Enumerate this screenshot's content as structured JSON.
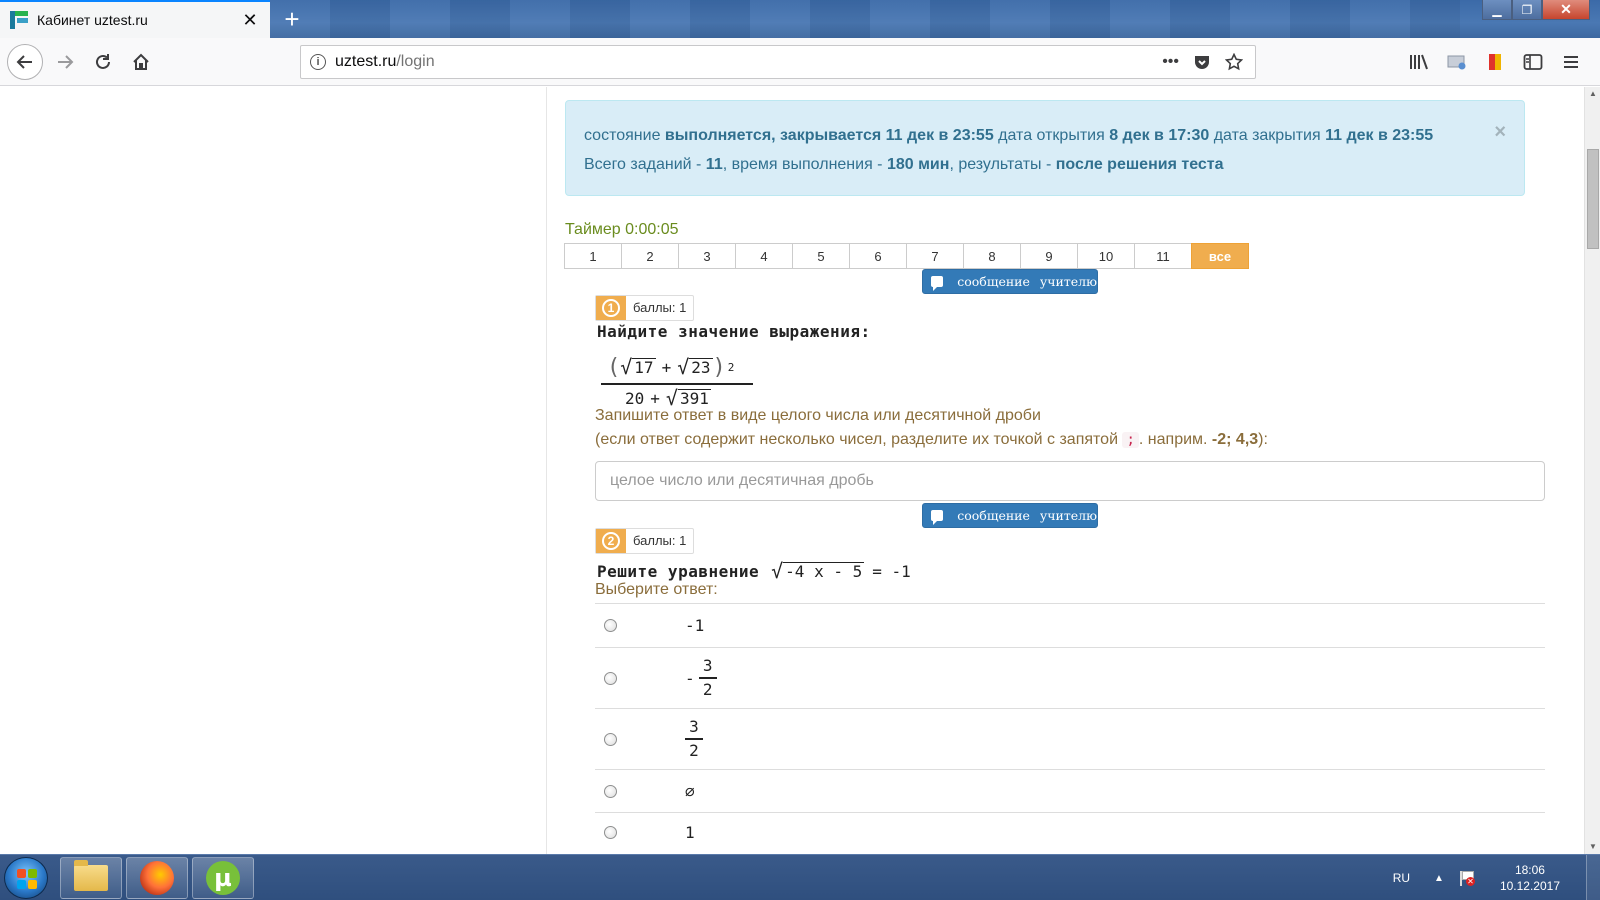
{
  "browser": {
    "tab_title": "Кабинет uztest.ru",
    "url_host": "uztest.ru",
    "url_path": "/login",
    "new_tab": "+",
    "tab_close": "✕",
    "more_actions": "•••"
  },
  "alert": {
    "line1": [
      {
        "t": "состояние ",
        "b": false
      },
      {
        "t": "выполняется, закрывается 11 дек в 23:55",
        "b": true
      },
      {
        "t": " дата открытия ",
        "b": false
      },
      {
        "t": "8 дек в 17:30",
        "b": true
      },
      {
        "t": " дата закрытия ",
        "b": false
      },
      {
        "t": "11 дек в 23:55",
        "b": true
      }
    ],
    "line2": [
      {
        "t": "Всего заданий - ",
        "b": false
      },
      {
        "t": "11",
        "b": true
      },
      {
        "t": ", время выполнения - ",
        "b": false
      },
      {
        "t": "180 мин",
        "b": true
      },
      {
        "t": ", результаты - ",
        "b": false
      },
      {
        "t": "после решения теста",
        "b": true
      }
    ],
    "close": "×"
  },
  "timer": "Таймер 0:00:05",
  "question_nav": [
    "1",
    "2",
    "3",
    "4",
    "5",
    "6",
    "7",
    "8",
    "9",
    "10",
    "11",
    "все"
  ],
  "message_button": {
    "word1": "сообщение",
    "word2": "учителю"
  },
  "q1": {
    "number": "1",
    "score": "баллы: 1",
    "title": "Найдите значение выражения:",
    "numerator": {
      "a": "17",
      "op": "+",
      "b": "23",
      "power": "2"
    },
    "denominator": {
      "a": "20",
      "op": "+",
      "b": "391"
    },
    "hint1": "Запишите ответ в виде целого числа или десятичной дроби",
    "hint2_pre": "(если ответ содержит несколько чисел, разделите их точкой с запятой ",
    "hint2_code": ";",
    "hint2_mid": ". наприм. ",
    "hint2_example": "-2; 4,3",
    "hint2_post": "):",
    "placeholder": "целое число или десятичная дробь"
  },
  "q2": {
    "number": "2",
    "score": "баллы: 1",
    "title": "Решите уравнение",
    "radicand": "-4 x - 5",
    "rhs": "= -1",
    "choose": "Выберите ответ:",
    "options": [
      {
        "type": "text",
        "value": "-1"
      },
      {
        "type": "frac",
        "sign": "-",
        "num": "3",
        "den": "2"
      },
      {
        "type": "frac",
        "sign": "",
        "num": "3",
        "den": "2"
      },
      {
        "type": "text",
        "value": "∅"
      },
      {
        "type": "text",
        "value": "1"
      }
    ]
  },
  "taskbar": {
    "lang": "RU",
    "time": "18:06",
    "date": "10.12.2017"
  },
  "colors": {
    "accent": "#f0ad4e",
    "primary": "#337ab7",
    "alert_bg": "#d9edf7",
    "alert_text": "#31708f",
    "hint_text": "#8a6d3b",
    "timer_text": "#6a8c1e"
  }
}
